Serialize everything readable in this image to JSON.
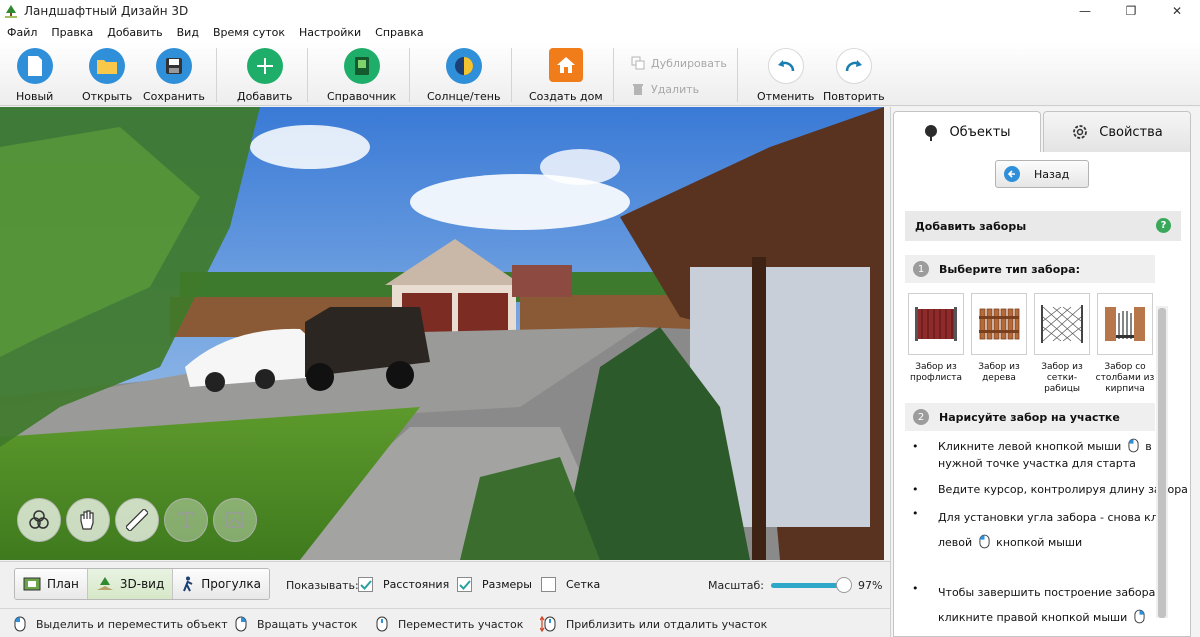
{
  "window": {
    "title": "Ландшафтный Дизайн 3D",
    "controls": [
      "—",
      "❐",
      "✕"
    ]
  },
  "menu": [
    "Файл",
    "Правка",
    "Добавить",
    "Вид",
    "Время суток",
    "Настройки",
    "Справка"
  ],
  "toolbar": {
    "new": "Новый",
    "open": "Открыть",
    "save": "Сохранить",
    "add": "Добавить",
    "reference": "Справочник",
    "sun_shadow": "Солнце/тень",
    "create_house": "Создать дом",
    "duplicate": "Дублировать",
    "delete": "Удалить",
    "undo": "Отменить",
    "redo": "Повторить"
  },
  "colors": {
    "accent_blue": "#2f8fd8",
    "add_green": "#1fae6a",
    "house_orange": "#f07d1a",
    "active_tab": "#d6e8c8"
  },
  "view_tabs": [
    "План",
    "3D-вид",
    "Прогулка"
  ],
  "active_view": "3D-вид",
  "show": {
    "label": "Показывать:",
    "distances": {
      "label": "Расстояния",
      "checked": true
    },
    "sizes": {
      "label": "Размеры",
      "checked": true
    },
    "grid": {
      "label": "Сетка",
      "checked": false
    }
  },
  "zoom": {
    "label": "Масштаб:",
    "value": "97%",
    "fraction": 0.97
  },
  "status_hints": [
    "Выделить и переместить объект",
    "Вращать участок",
    "Переместить участок",
    "Приблизить или отдалить участок"
  ],
  "scene_tools": [
    "layers-icon",
    "hand-icon",
    "ruler-icon",
    "text-icon",
    "image-icon"
  ],
  "panel": {
    "tabs": {
      "objects": "Объекты",
      "properties": "Свойства"
    },
    "back": "Назад",
    "section_title": "Добавить заборы",
    "help": "?",
    "step1": {
      "num": "1",
      "title": "Выберите тип забора:"
    },
    "fences": [
      {
        "label": "Забор из профлиста"
      },
      {
        "label": "Забор из дерева"
      },
      {
        "label": "Забор из сетки-рабицы"
      },
      {
        "label": "Забор со столбами из кирпича"
      }
    ],
    "step2": {
      "num": "2",
      "title": "Нарисуйте забор на участке"
    },
    "bullets": {
      "b1a": "Кликните левой кнопкой мыши",
      "b1b": "в",
      "b1c": "нужной точке участка для старта",
      "b2": "Ведите курсор, контролируя длину забора",
      "b3a": "Для установки угла забора - снова кликните",
      "b3b": "левой",
      "b3c": "кнопкой мыши",
      "b4a": "Чтобы завершить построение забора -",
      "b4b": "кликните правой кнопкой мыши"
    },
    "bullet_mark": "•"
  }
}
